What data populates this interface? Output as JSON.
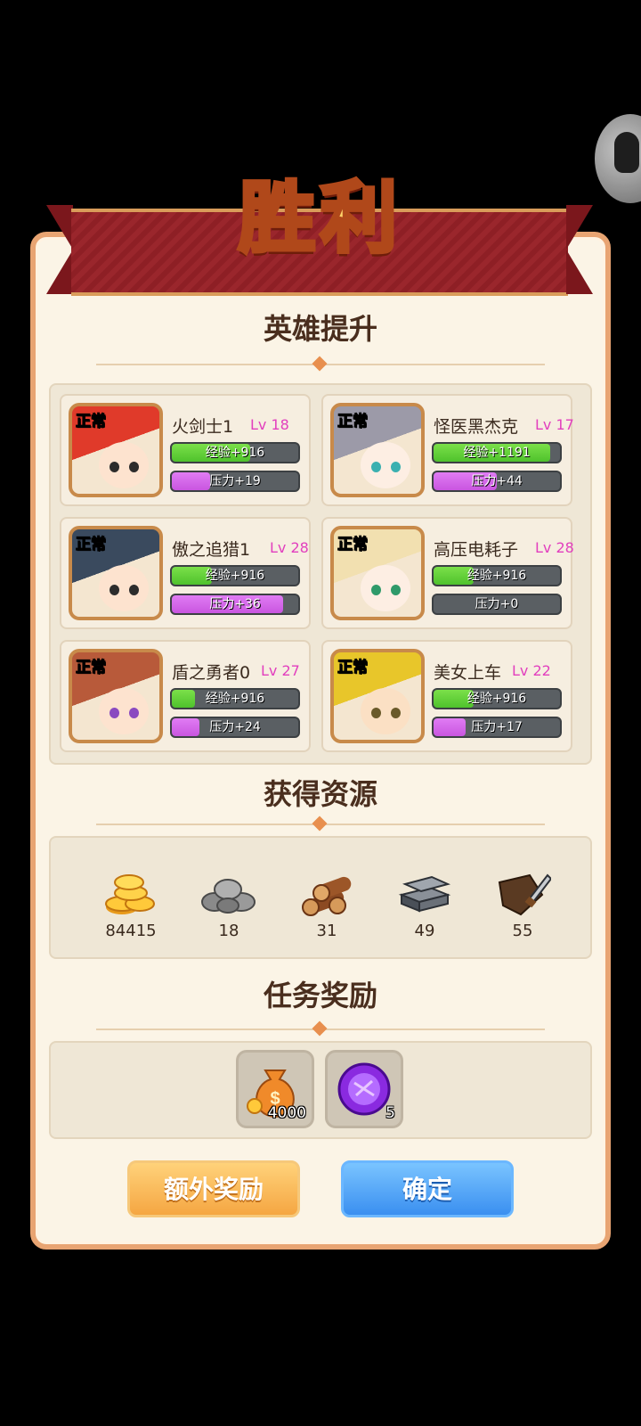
{
  "title": "胜利",
  "sections": {
    "heroes_title": "英雄提升",
    "resources_title": "获得资源",
    "tasks_title": "任务奖励"
  },
  "heroes": [
    {
      "status": "正常",
      "name": "火剑士1",
      "level": "Lv 18",
      "exp": "经验+916",
      "exp_fill": 0.62,
      "pressure": "压力+19",
      "pressure_fill": 0.3,
      "hair": "#e03a2a",
      "skin": "#fde3cf",
      "eye": "#2c2c2c"
    },
    {
      "status": "正常",
      "name": "怪医黑杰克",
      "level": "Lv 17",
      "exp": "经验+1191",
      "exp_fill": 0.92,
      "pressure": "压力+44",
      "pressure_fill": 0.5,
      "hair": "#9c9aa8",
      "skin": "#fdeee3",
      "eye": "#3bb0b0"
    },
    {
      "status": "正常",
      "name": "傲之追猎1",
      "level": "Lv 28",
      "exp": "经验+916",
      "exp_fill": 0.32,
      "pressure": "压力+36",
      "pressure_fill": 0.88,
      "hair": "#3a4a5e",
      "skin": "#fde3cf",
      "eye": "#2c2c2c"
    },
    {
      "status": "正常",
      "name": "高压电耗子",
      "level": "Lv 28",
      "exp": "经验+916",
      "exp_fill": 0.32,
      "pressure": "压力+0",
      "pressure_fill": 0,
      "hair": "#f2e0b0",
      "skin": "#fdeee3",
      "eye": "#2f9a6a"
    },
    {
      "status": "正常",
      "name": "盾之勇者0",
      "level": "Lv 27",
      "exp": "经验+916",
      "exp_fill": 0.18,
      "pressure": "压力+24",
      "pressure_fill": 0.22,
      "hair": "#b85a3a",
      "skin": "#fde3cf",
      "eye": "#8a4ac0"
    },
    {
      "status": "正常",
      "name": "美女上车",
      "level": "Lv 22",
      "exp": "经验+916",
      "exp_fill": 0.32,
      "pressure": "压力+17",
      "pressure_fill": 0.25,
      "hair": "#e8c62a",
      "skin": "#fbe0c4",
      "eye": "#6a5a2a"
    }
  ],
  "resources": [
    {
      "icon": "gold-coins-icon",
      "count": "84415"
    },
    {
      "icon": "stone-pile-icon",
      "count": "18"
    },
    {
      "icon": "wood-logs-icon",
      "count": "31"
    },
    {
      "icon": "iron-ingots-icon",
      "count": "49"
    },
    {
      "icon": "leather-hide-icon",
      "count": "55"
    }
  ],
  "task_rewards": [
    {
      "icon": "money-bag-icon",
      "count": "4000"
    },
    {
      "icon": "purple-orb-icon",
      "count": "5"
    }
  ],
  "buttons": {
    "extra": "额外奖励",
    "confirm": "确定"
  },
  "colors": {
    "panel": "#fbf4e6",
    "border": "#e8a472",
    "exp_bar": "#4fc22c",
    "pressure_bar": "#c955e0",
    "level_text": "#e23fbe"
  }
}
